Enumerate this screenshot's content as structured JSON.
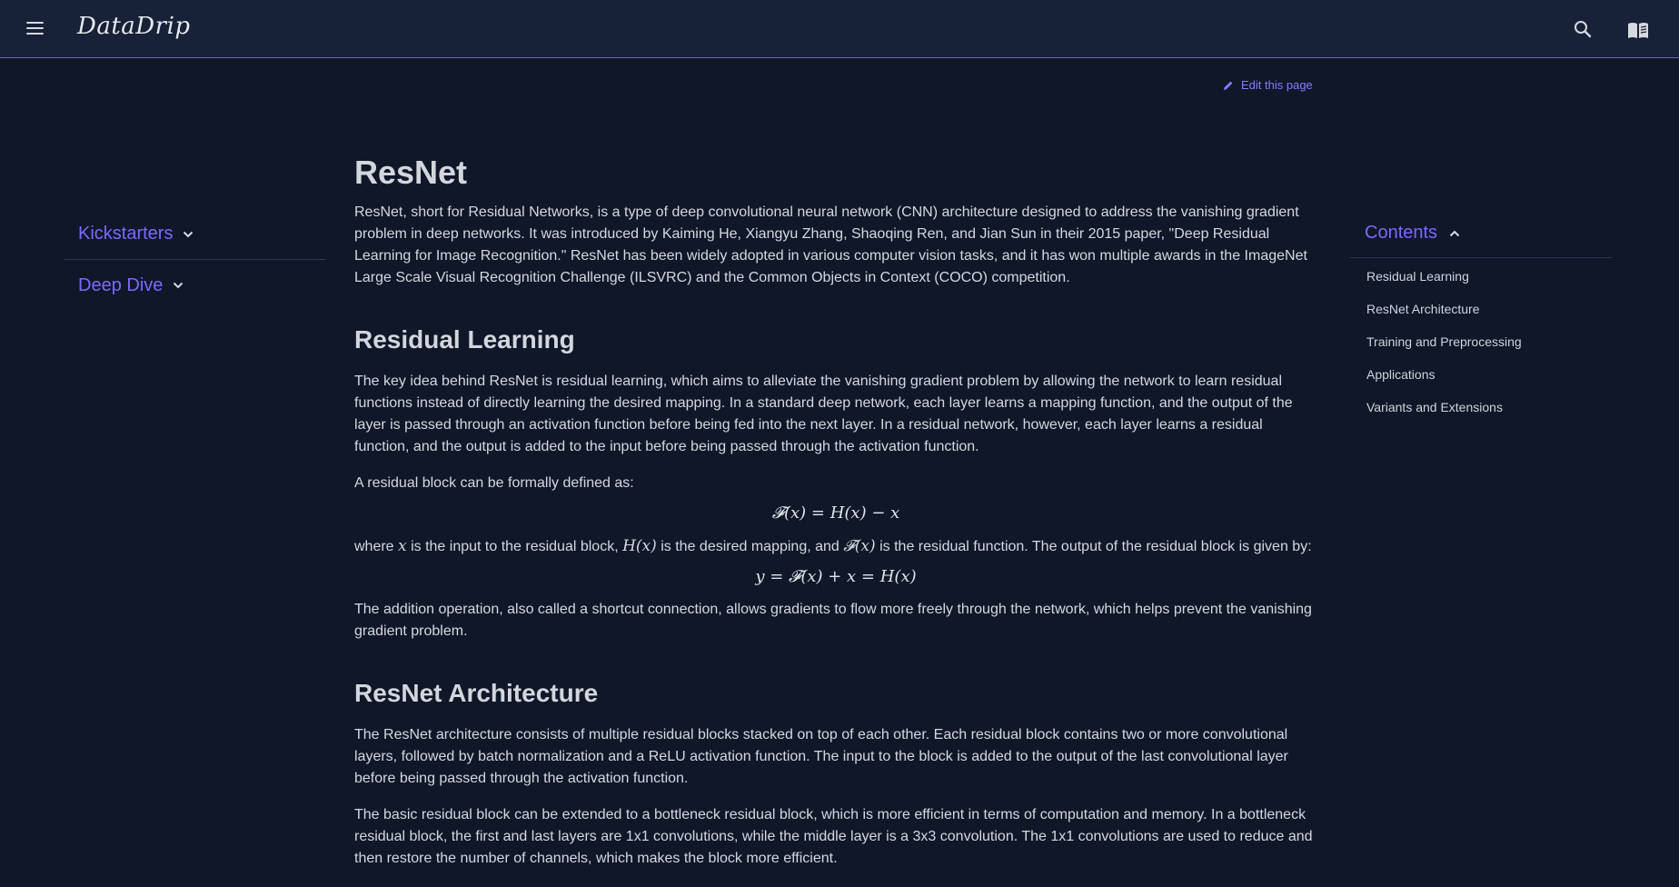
{
  "header": {
    "brand": "DataDrip",
    "menu_icon": "menu-icon",
    "search_icon": "search-icon",
    "book_icon": "book-icon"
  },
  "edit_link": {
    "label": "Edit this page",
    "icon": "pencil-icon"
  },
  "left_nav": {
    "items": [
      {
        "label": "Kickstarters",
        "icon": "chevron-down-icon"
      },
      {
        "label": "Deep Dive",
        "icon": "chevron-down-icon"
      }
    ]
  },
  "toc": {
    "title": "Contents",
    "icon": "chevron-up-icon",
    "items": [
      "Residual Learning",
      "ResNet Architecture",
      "Training and Preprocessing",
      "Applications",
      "Variants and Extensions"
    ]
  },
  "article": {
    "title": "ResNet",
    "intro": "ResNet, short for Residual Networks, is a type of deep convolutional neural network (CNN) architecture designed to address the vanishing gradient problem in deep networks. It was introduced by Kaiming He, Xiangyu Zhang, Shaoqing Ren, and Jian Sun in their 2015 paper, \"Deep Residual Learning for Image Recognition.\" ResNet has been widely adopted in various computer vision tasks, and it has won multiple awards in the ImageNet Large Scale Visual Recognition Challenge (ILSVRC) and the Common Objects in Context (COCO) competition.",
    "section1": {
      "heading": "Residual Learning",
      "p1": "The key idea behind ResNet is residual learning, which aims to alleviate the vanishing gradient problem by allowing the network to learn residual functions instead of directly learning the desired mapping. In a standard deep network, each layer learns a mapping function, and the output of the layer is passed through an activation function before being fed into the next layer. In a residual network, however, each layer learns a residual function, and the output is added to the input before being passed through the activation function.",
      "p2": "A residual block can be formally defined as:",
      "eq1": "𝓕(x) = H(x) − x",
      "p3_a": "where ",
      "p3_x": "x",
      "p3_b": " is the input to the residual block, ",
      "p3_h": "H(x)",
      "p3_c": " is the desired mapping, and ",
      "p3_f": "𝓕(x)",
      "p3_d": " is the residual function. The output of the residual block is given by:",
      "eq2": "y = 𝓕(x) + x = H(x)",
      "p4": "The addition operation, also called a shortcut connection, allows gradients to flow more freely through the network, which helps prevent the vanishing gradient problem."
    },
    "section2": {
      "heading": "ResNet Architecture",
      "p1": "The ResNet architecture consists of multiple residual blocks stacked on top of each other. Each residual block contains two or more convolutional layers, followed by batch normalization and a ReLU activation function. The input to the block is added to the output of the last convolutional layer before being passed through the activation function.",
      "p2": "The basic residual block can be extended to a bottleneck residual block, which is more efficient in terms of computation and memory. In a bottleneck residual block, the first and last layers are 1x1 convolutions, while the middle layer is a 3x3 convolution. The 1x1 convolutions are used to reduce and then restore the number of channels, which makes the block more efficient."
    }
  }
}
